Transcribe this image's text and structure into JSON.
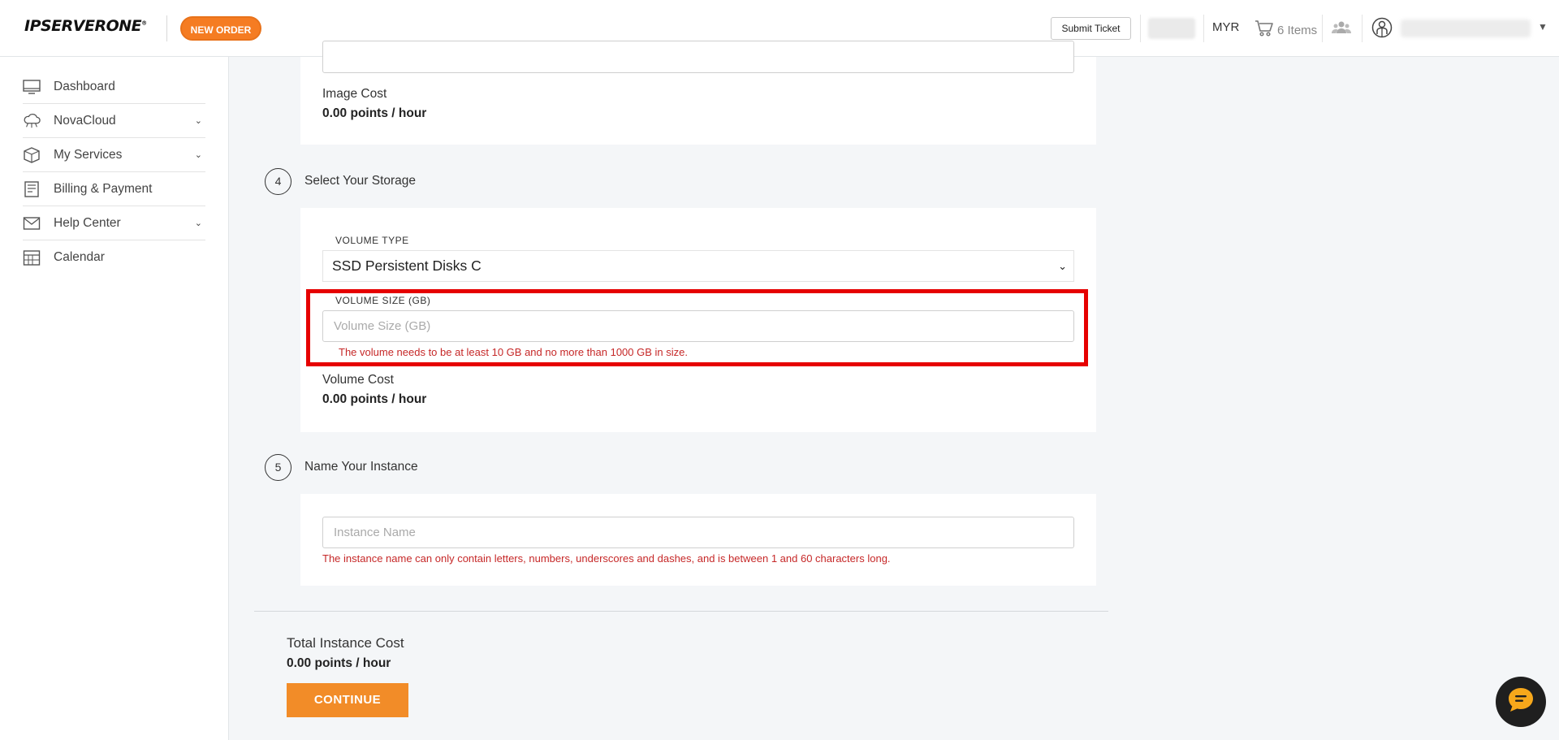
{
  "header": {
    "brand": "IPSERVERONE",
    "new_order_label": "NEW ORDER",
    "submit_ticket_label": "Submit Ticket",
    "currency": "MYR",
    "cart_label": "6 Items"
  },
  "sidebar": {
    "items": [
      {
        "label": "Dashboard",
        "icon": "monitor-icon"
      },
      {
        "label": "NovaCloud",
        "icon": "cloud-icon"
      },
      {
        "label": "My Services",
        "icon": "box-icon"
      },
      {
        "label": "Billing & Payment",
        "icon": "invoice-icon"
      },
      {
        "label": "Help Center",
        "icon": "mail-icon"
      },
      {
        "label": "Calendar",
        "icon": "calendar-icon"
      }
    ]
  },
  "image_section": {
    "cost_label": "Image Cost",
    "cost_value": "0.00 points / hour"
  },
  "storage_section": {
    "step_number": "4",
    "title": "Select Your Storage",
    "volume_type_label": "VOLUME TYPE",
    "volume_type_value": "SSD Persistent Disks C",
    "volume_size_label": "VOLUME SIZE (GB)",
    "volume_size_placeholder": "Volume Size (GB)",
    "volume_size_error": "The volume needs to be at least 10 GB and no more than 1000 GB in size.",
    "cost_label": "Volume Cost",
    "cost_value": "0.00 points / hour"
  },
  "name_section": {
    "step_number": "5",
    "title": "Name Your Instance",
    "instance_name_placeholder": "Instance Name",
    "instance_name_error": "The instance name can only contain letters, numbers, underscores and dashes, and is between 1 and 60 characters long."
  },
  "summary": {
    "total_label": "Total Instance Cost",
    "total_value": "0.00 points / hour",
    "continue_label": "CONTINUE"
  },
  "colors": {
    "accent": "#f28c28",
    "error": "#c62828",
    "highlight": "#e60000"
  }
}
